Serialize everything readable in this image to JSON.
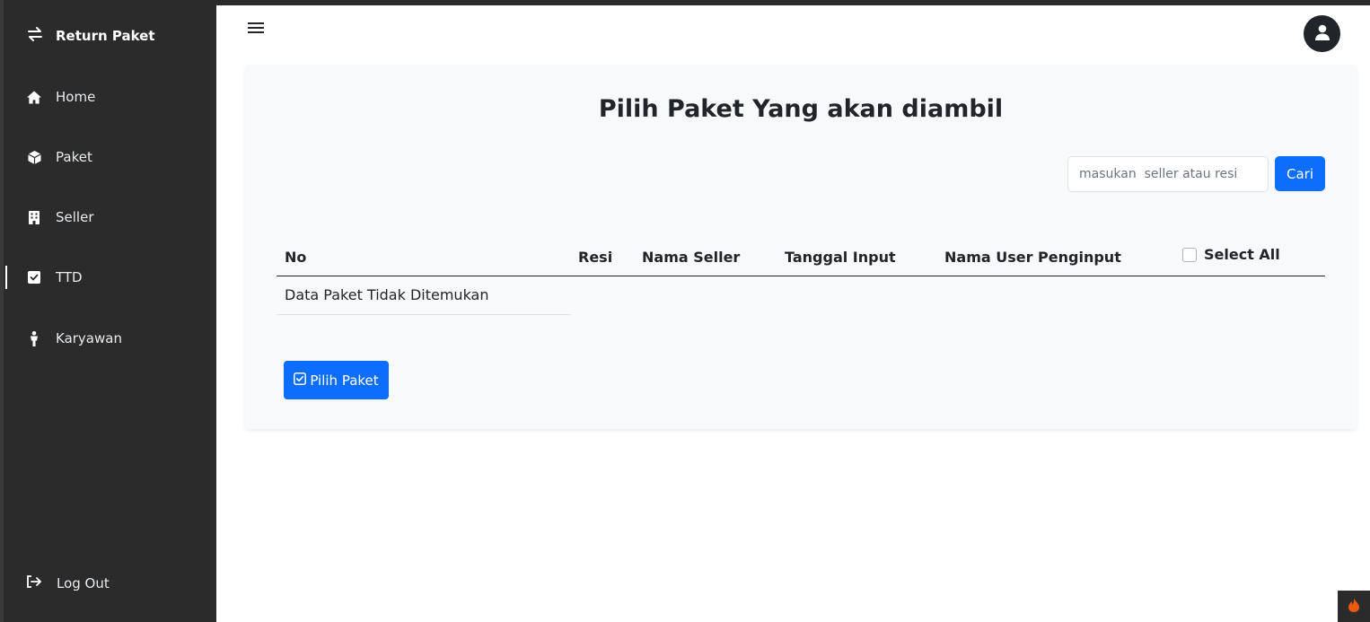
{
  "sidebar": {
    "brand": "Return Paket",
    "items": [
      {
        "label": "Home",
        "icon": "home-icon"
      },
      {
        "label": "Paket",
        "icon": "box-icon"
      },
      {
        "label": "Seller",
        "icon": "building-icon"
      },
      {
        "label": "TTD",
        "icon": "check-square-icon"
      },
      {
        "label": "Karyawan",
        "icon": "person-icon"
      }
    ],
    "logout": "Log Out"
  },
  "main": {
    "title": "Pilih Paket Yang akan diambil",
    "search": {
      "placeholder": "masukan  seller atau resi",
      "button": "Cari"
    },
    "table": {
      "columns": [
        "No",
        "Resi",
        "Nama Seller",
        "Tanggal Input",
        "Nama User Penginput"
      ],
      "select_all": "Select All",
      "empty_message": "Data Paket Tidak Ditemukan"
    },
    "pick_button": "Pilih Paket"
  },
  "colors": {
    "sidebar": "#2b2b2b",
    "primary": "#0d6efd",
    "card": "#f8f9fa"
  }
}
